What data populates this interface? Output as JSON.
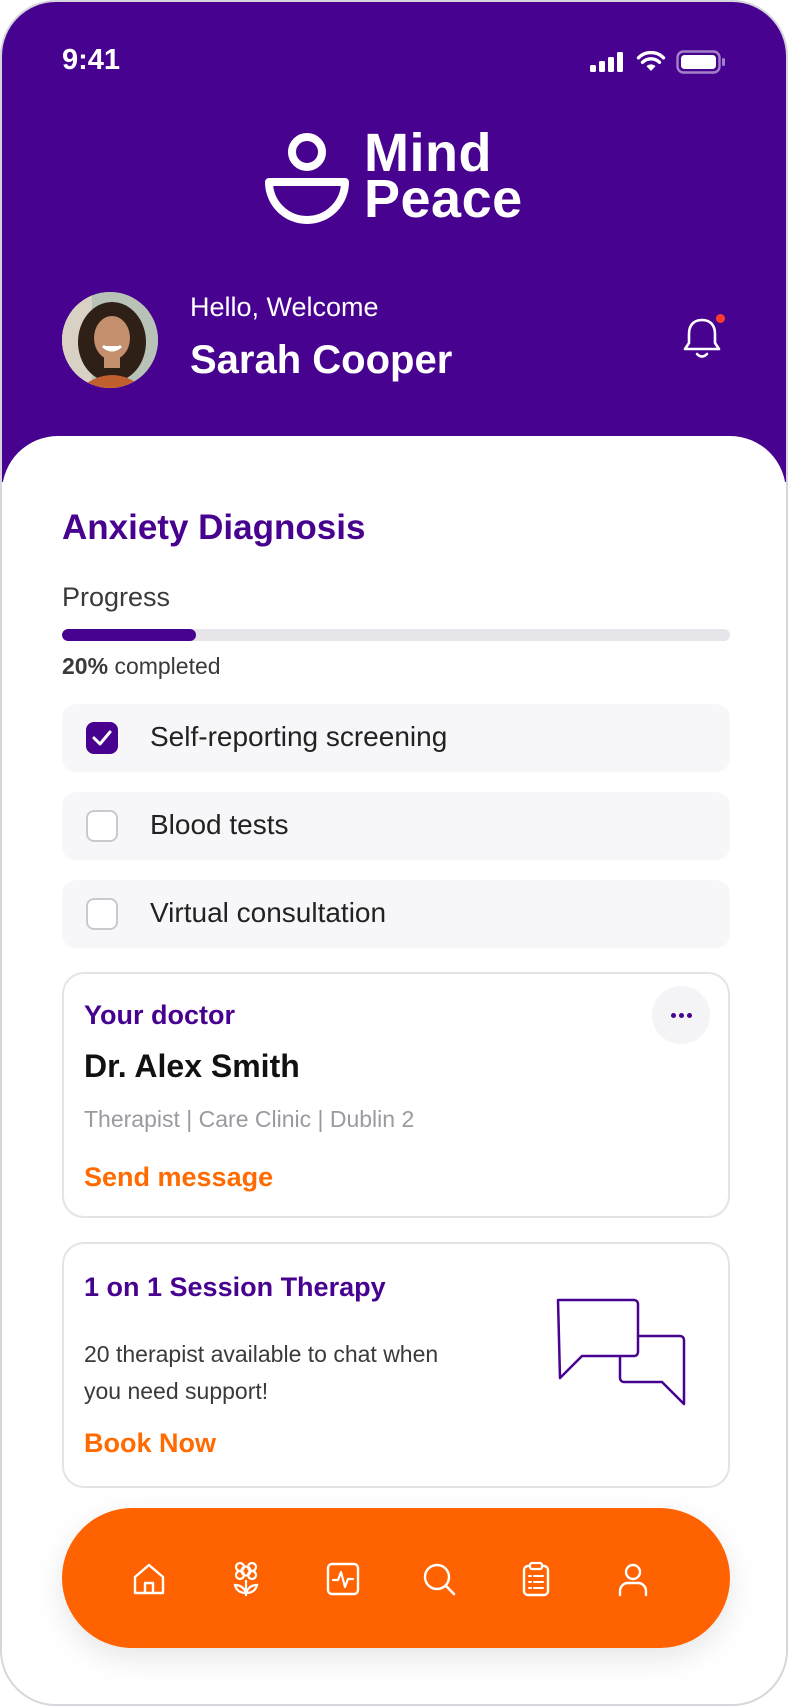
{
  "status_bar": {
    "time": "9:41"
  },
  "brand": {
    "name_line1": "Mind",
    "name_line2": "Peace"
  },
  "user": {
    "greeting": "Hello, Welcome",
    "name": "Sarah Cooper"
  },
  "diagnosis": {
    "title": "Anxiety Diagnosis",
    "progress_label": "Progress",
    "progress_percent": 20,
    "progress_value_text": "20%",
    "progress_suffix": "completed",
    "steps": [
      {
        "label": "Self-reporting screening",
        "checked": true
      },
      {
        "label": "Blood tests",
        "checked": false
      },
      {
        "label": "Virtual consultation",
        "checked": false
      }
    ]
  },
  "doctor_card": {
    "eyebrow": "Your doctor",
    "name": "Dr. Alex Smith",
    "meta": "Therapist | Care Clinic | Dublin 2",
    "action": "Send message"
  },
  "session_card": {
    "title": "1 on 1 Session Therapy",
    "description": "20 therapist available to chat when you need support!",
    "action": "Book Now"
  },
  "bottom_nav": {
    "items": [
      "home-icon",
      "flower-icon",
      "activity-icon",
      "search-icon",
      "clipboard-icon",
      "profile-icon"
    ]
  },
  "colors": {
    "primary": "#470290",
    "accent": "#ff6200",
    "notification": "#ff3b30"
  }
}
